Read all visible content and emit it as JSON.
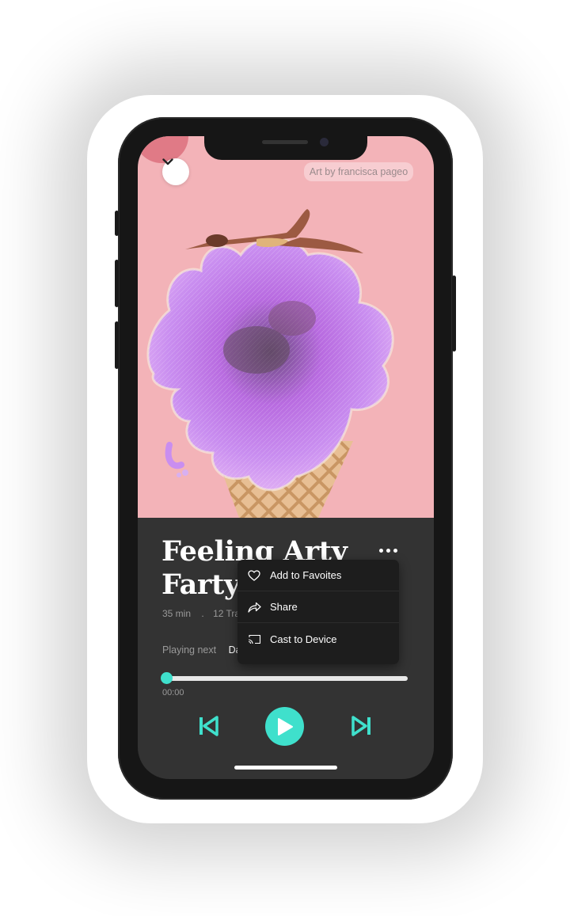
{
  "art": {
    "credit": "Art by francisca pageo",
    "collapse_icon": "chevron-down-icon"
  },
  "album": {
    "title_line1": "Feeling Arty",
    "title_line2": "Farty",
    "duration": "35 min",
    "separator": ".",
    "tracks": "12 Trac",
    "more_icon": "more-horizontal-icon"
  },
  "up_next": {
    "label": "Playing next",
    "track": "Da"
  },
  "menu": {
    "items": [
      {
        "label": "Add to Favoites",
        "icon": "heart-icon"
      },
      {
        "label": "Share",
        "icon": "share-icon"
      },
      {
        "label": "Cast to Device",
        "icon": "cast-icon"
      }
    ]
  },
  "player": {
    "elapsed": "00:00",
    "progress": 0,
    "accent": "#3fe0cc"
  },
  "colors": {
    "art_bg": "#f3b3b8",
    "panel_bg": "#333333",
    "menu_bg": "#1d1d1d"
  }
}
